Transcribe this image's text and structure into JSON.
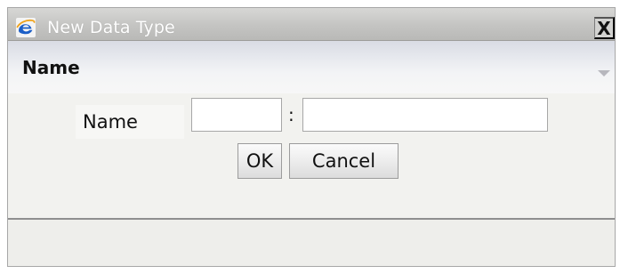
{
  "window": {
    "title": "New Data Type",
    "close_label": "X",
    "app_icon": "internet-explorer-icon"
  },
  "section": {
    "title": "Name",
    "collapse_icon": "collapse-triangle-icon"
  },
  "form": {
    "name_label": "Name",
    "separator": ":",
    "first_input": {
      "value": "",
      "placeholder": ""
    },
    "second_input": {
      "value": "",
      "placeholder": ""
    }
  },
  "buttons": {
    "ok_label": "OK",
    "cancel_label": "Cancel"
  },
  "colors": {
    "title_text": "#ffffff",
    "titlebar": "#c4c4c2",
    "header": "#e8eaef",
    "body": "#f2f2ef"
  }
}
